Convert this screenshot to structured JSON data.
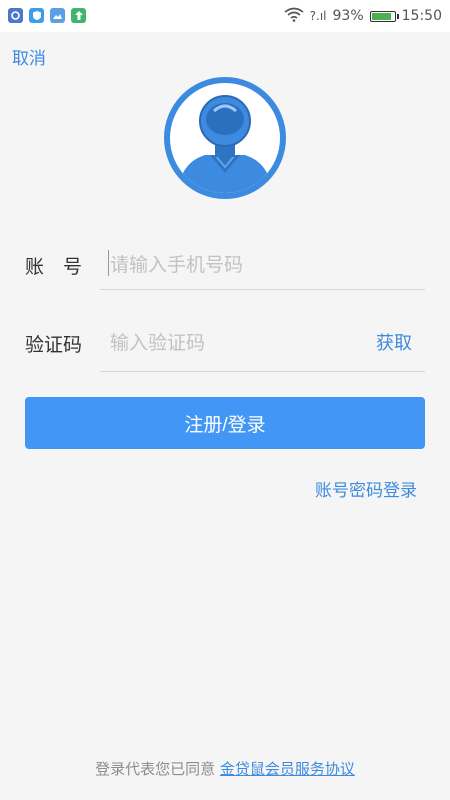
{
  "status_bar": {
    "battery_percent": "93%",
    "battery_level": 0.93,
    "time": "15:50",
    "signal_text": "?.ıl"
  },
  "header": {
    "cancel_label": "取消"
  },
  "form": {
    "account_label": "账　号",
    "account_placeholder": "请输入手机号码",
    "code_label": "验证码",
    "code_placeholder": "输入验证码",
    "get_code_label": "获取"
  },
  "actions": {
    "submit_label": "注册/登录",
    "password_login_label": "账号密码登录"
  },
  "footer": {
    "agreement_prefix": "登录代表您已同意",
    "agreement_link": "金贷鼠会员服务协议"
  },
  "colors": {
    "accent": "#3d8be0",
    "button": "#4196f6",
    "background": "#f5f5f5"
  }
}
